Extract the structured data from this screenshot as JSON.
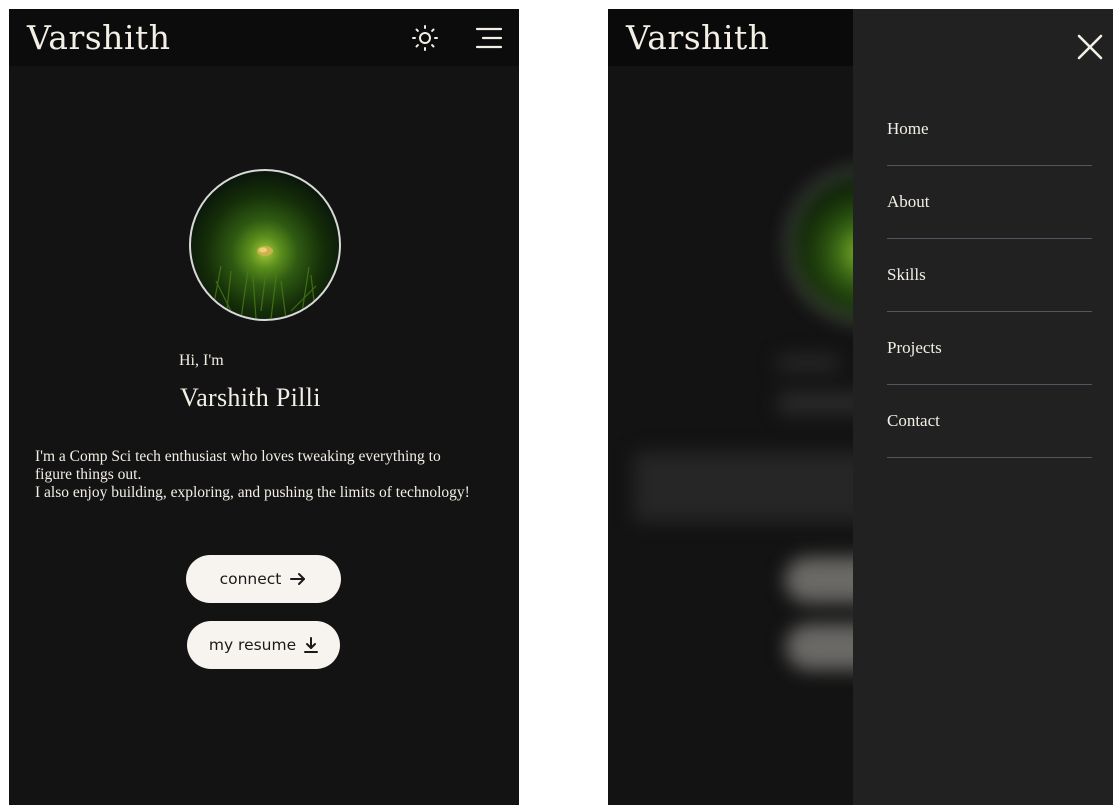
{
  "site": {
    "brand": "Varshith"
  },
  "header": {
    "theme_toggle_icon": "sun-icon",
    "menu_icon": "hamburger-menu-icon"
  },
  "hero": {
    "greeting": "Hi, I'm",
    "name": "Varshith Pilli",
    "bio_line1": "I'm a Comp Sci tech enthusiast who loves tweaking everything to figure things out.",
    "bio_line2": "I also enjoy building, exploring, and pushing the limits of technology!",
    "connect_label": "connect",
    "connect_icon": "arrow-right-icon",
    "resume_label": "my resume",
    "resume_icon": "download-icon"
  },
  "drawer": {
    "close_icon": "close-icon",
    "items": [
      {
        "label": "Home"
      },
      {
        "label": "About"
      },
      {
        "label": "Skills"
      },
      {
        "label": "Projects"
      },
      {
        "label": "Contact"
      }
    ]
  },
  "colors": {
    "page_bg": "#131313",
    "header_bg": "#0c0c0c",
    "drawer_bg": "#212121",
    "text": "#f3efe6",
    "button_bg": "#f7f4ef",
    "divider": "#54565f"
  }
}
